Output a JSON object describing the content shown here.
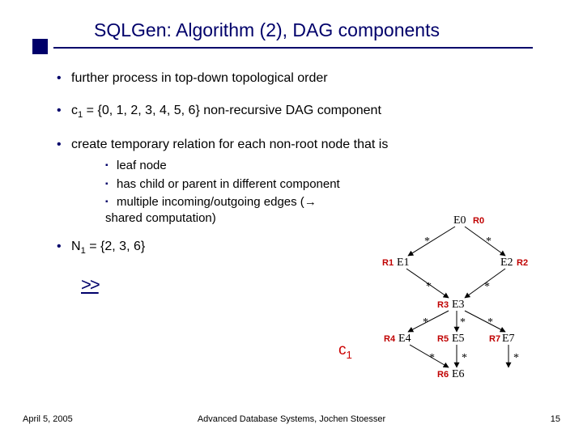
{
  "title": "SQLGen: Algorithm (2), DAG components",
  "bullets": {
    "b1": "further process in top-down topological order",
    "b2_pre": "c",
    "b2_sub": "1",
    "b2_post": " = {0, 1, 2, 3, 4, 5, 6} non-recursive DAG component",
    "b3": "create temporary relation for each non-root node that is",
    "sub1": "leaf node",
    "sub2": "has child or parent in different component",
    "sub3_pre": "multiple incoming/outgoing edges (",
    "sub3_arrow": "→",
    "sub3_post": " shared computation)",
    "b4_pre": "N",
    "b4_sub": "1",
    "b4_post": " = {2, 3, 6}"
  },
  "chevrons": ">>",
  "c1_label": {
    "c": "c",
    "sub": "1"
  },
  "diagram": {
    "nodes": {
      "E0": "E0",
      "E1": "E1",
      "E2": "E2",
      "E3": "E3",
      "E4": "E4",
      "E5": "E5",
      "E6": "E6",
      "E7": "E7"
    },
    "labels": {
      "R0": "R0",
      "R1": "R1",
      "R2": "R2",
      "R3": "R3",
      "R4": "R4",
      "R5": "R5",
      "R6": "R6",
      "R7": "R7"
    },
    "star": "*"
  },
  "footer": {
    "date": "April 5, 2005",
    "center": "Advanced Database Systems, Jochen Stoesser",
    "page": "15"
  }
}
